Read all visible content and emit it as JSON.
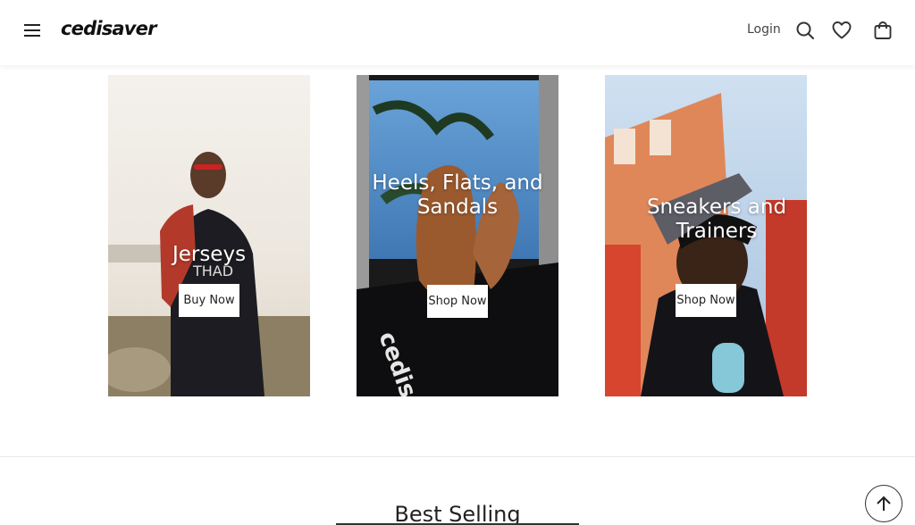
{
  "header": {
    "logo": "cedisaver",
    "login_label": "Login",
    "icons": [
      "menu-icon",
      "search-icon",
      "heart-icon",
      "shopping-bag-icon"
    ]
  },
  "categories": [
    {
      "title": "Jerseys",
      "button": "Buy Now"
    },
    {
      "title": "Heels, Flats, and Sandals",
      "button": "Shop Now"
    },
    {
      "title": "Sneakers and Trainers",
      "button": "Shop Now"
    }
  ],
  "best_selling": {
    "title": "Best Selling"
  },
  "scroll_top_icon": "arrow-up-icon"
}
